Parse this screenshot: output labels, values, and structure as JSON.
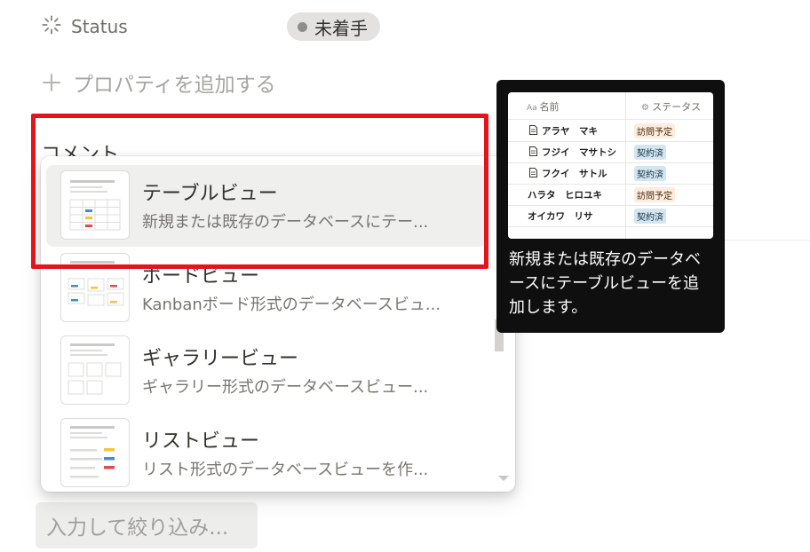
{
  "status_row": {
    "label": "Status",
    "value": "未着手"
  },
  "add_property": {
    "label": "プロパティを追加する"
  },
  "comment": {
    "label": "コメント"
  },
  "filter": {
    "placeholder": "入力して絞り込み..."
  },
  "menu": {
    "items": [
      {
        "title": "テーブルビュー",
        "desc": "新規または既存のデータベースにテー...",
        "thumb": "table-view-thumbnail-icon",
        "selected": true
      },
      {
        "title": "ボードビュー",
        "desc": "Kanbanボード形式のデータベースビュ...",
        "thumb": "board-view-thumbnail-icon",
        "selected": false
      },
      {
        "title": "ギャラリービュー",
        "desc": "ギャラリー形式のデータベースビュー...",
        "thumb": "gallery-view-thumbnail-icon",
        "selected": false
      },
      {
        "title": "リストビュー",
        "desc": "リスト形式のデータベースビューを作...",
        "thumb": "list-view-thumbnail-icon",
        "selected": false
      }
    ]
  },
  "tooltip": {
    "text": "新規または既存のデータベースにテーブルビューを追加します。",
    "preview": {
      "headers": {
        "name": "名前",
        "status": "ステータス"
      },
      "rows": [
        {
          "name": "アラヤ　マキ",
          "status": "訪問予定",
          "status_type": "visit",
          "has_icon": true
        },
        {
          "name": "フジイ　マサトシ",
          "status": "契約済",
          "status_type": "done",
          "has_icon": true
        },
        {
          "name": "フクイ　サトル",
          "status": "契約済",
          "status_type": "done",
          "has_icon": true
        },
        {
          "name": "ハラタ　ヒロユキ",
          "status": "訪問予定",
          "status_type": "visit",
          "has_icon": false
        },
        {
          "name": "オイカワ　リサ",
          "status": "契約済",
          "status_type": "done",
          "has_icon": false
        }
      ]
    }
  },
  "colors": {
    "highlight": "#e3141c",
    "tag_visit_bg": "#fbecdd",
    "tag_done_bg": "#d3e5ef",
    "thumb_yellow": "#f5c242",
    "thumb_red": "#e5484d",
    "thumb_blue": "#3b8fd4"
  }
}
